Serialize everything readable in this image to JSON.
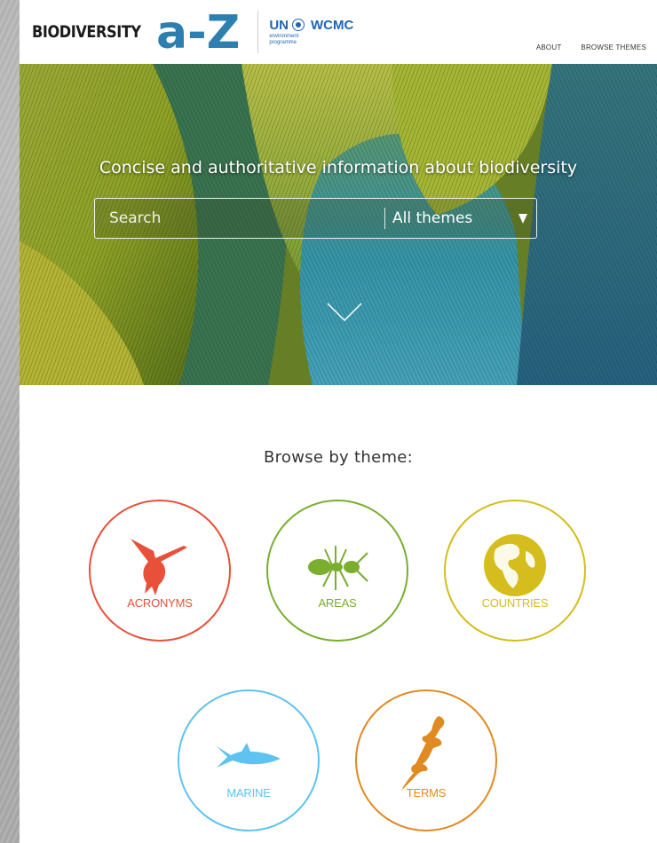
{
  "header": {
    "logo_text": "BIODIVERSITY",
    "logo_az": "a-Z",
    "partner_top": "UN",
    "partner_name": "WCMC",
    "partner_sub1": "environment",
    "partner_sub2": "programme",
    "nav": [
      {
        "label": "ABOUT"
      },
      {
        "label": "BROWSE THEMES"
      }
    ]
  },
  "hero": {
    "tagline": "Concise and authoritative information about biodiversity",
    "search_placeholder": "Search",
    "theme_select_value": "All themes"
  },
  "browse": {
    "title": "Browse by theme:",
    "themes": [
      {
        "label": "ACRONYMS",
        "color": "#e8503a",
        "icon": "hummingbird-icon"
      },
      {
        "label": "AREAS",
        "color": "#7aae2f",
        "icon": "ant-icon"
      },
      {
        "label": "COUNTRIES",
        "color": "#d4bd1c",
        "icon": "globe-icon"
      },
      {
        "label": "MARINE",
        "color": "#5ec3f0",
        "icon": "shark-icon"
      },
      {
        "label": "TERMS",
        "color": "#e08a22",
        "icon": "lizard-icon"
      }
    ]
  }
}
